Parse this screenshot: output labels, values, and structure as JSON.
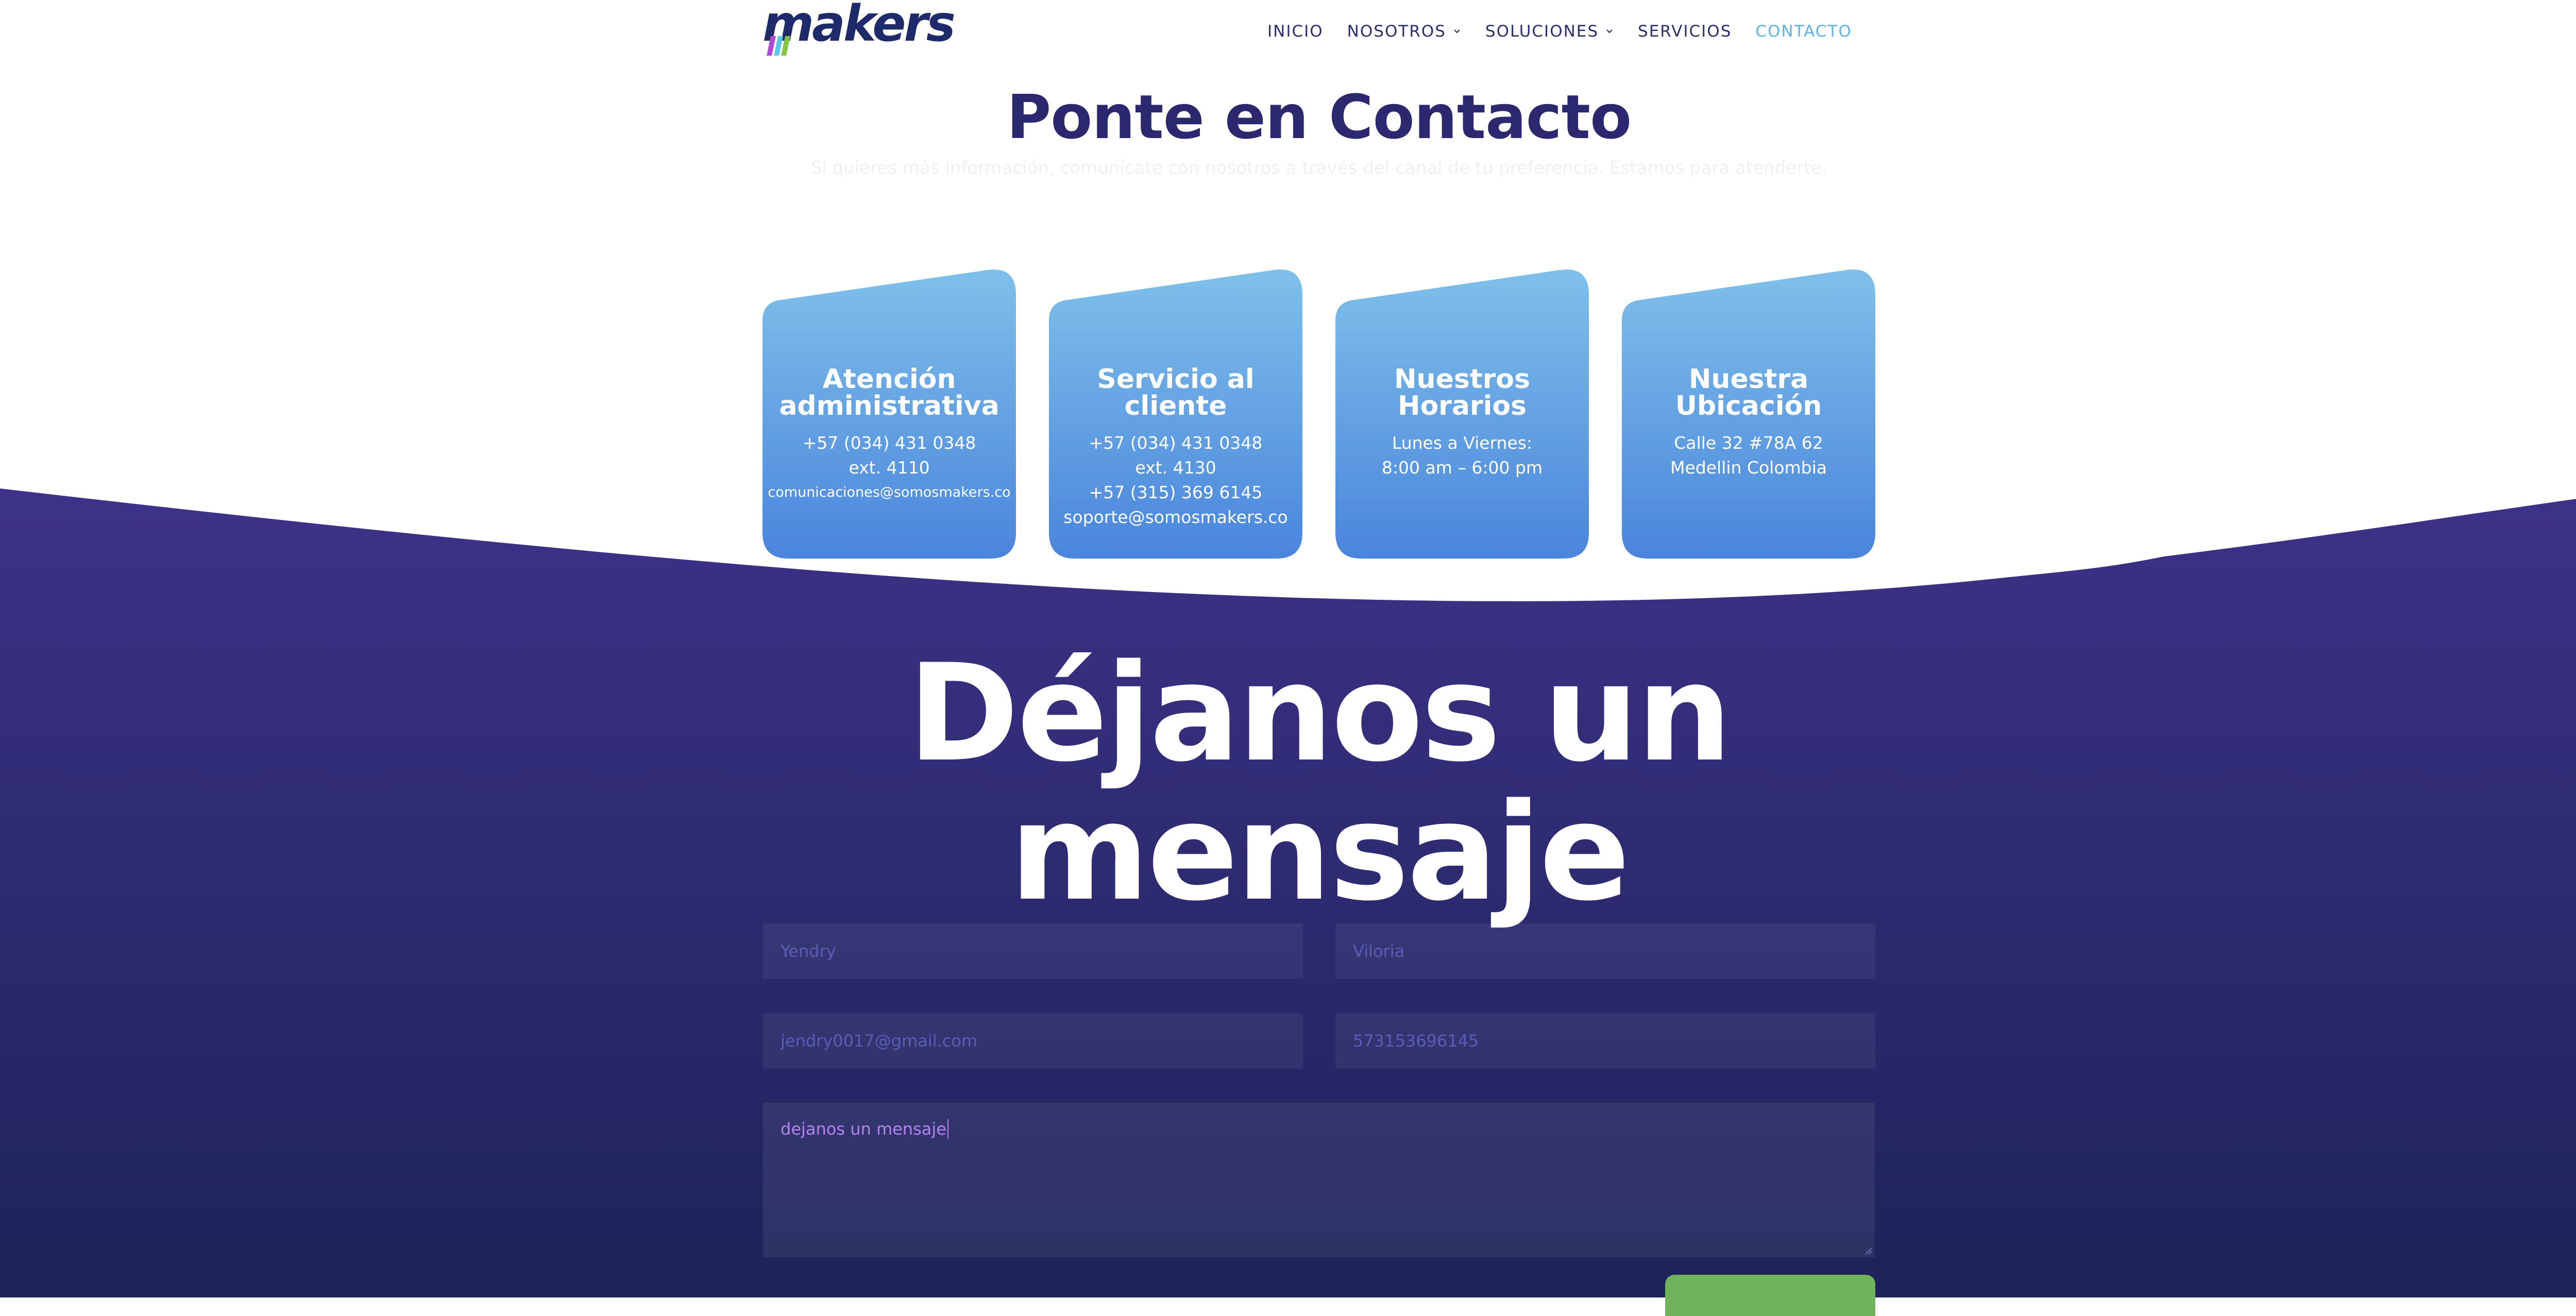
{
  "header": {
    "logo_text": "makers",
    "nav": [
      {
        "label": "INICIO",
        "has_dropdown": false,
        "active": false
      },
      {
        "label": "NOSOTROS",
        "has_dropdown": true,
        "active": false
      },
      {
        "label": "SOLUCIONES",
        "has_dropdown": true,
        "active": false
      },
      {
        "label": "SERVICIOS",
        "has_dropdown": false,
        "active": false
      },
      {
        "label": "CONTACTO",
        "has_dropdown": false,
        "active": true
      }
    ]
  },
  "intro": {
    "title": "Ponte en Contacto",
    "subtitle": "Si quieres más información, comunícate con nosotros a través del canal de tu preferencia. Estamos para atenderte."
  },
  "cards": [
    {
      "title": "Atención\nadministrativa",
      "lines": [
        "+57 (034) 431 0348",
        "ext. 4110",
        "comunicaciones@somosmakers.co"
      ]
    },
    {
      "title": "Servicio al\ncliente",
      "lines": [
        "+57 (034) 431 0348",
        "ext. 4130",
        "+57 (315) 369 6145",
        "soporte@somosmakers.co"
      ]
    },
    {
      "title": "Nuestros\nHorarios",
      "lines": [
        "Lunes a Viernes:",
        "8:00 am – 6:00 pm"
      ]
    },
    {
      "title": "Nuestra\nUbicación",
      "lines": [
        "Calle 32 #78A 62",
        "Medellin Colombia"
      ]
    }
  ],
  "message_section": {
    "heading": "Déjanos un\nmensaje"
  },
  "form": {
    "first_name": "Yendry",
    "last_name": "Viloria",
    "email": "jendry0017@gmail.com",
    "phone": "573153696145",
    "message": "dejanos un mensaje"
  },
  "colors": {
    "brand_navy": "#2c2870",
    "nav_active": "#5fb3e6",
    "card_top": "#7fc0ea",
    "card_bottom": "#4a85dc",
    "wave_top": "#3d3288",
    "wave_bottom": "#1d2358",
    "submit_green": "#6fb35a",
    "message_text": "#b782f0"
  }
}
